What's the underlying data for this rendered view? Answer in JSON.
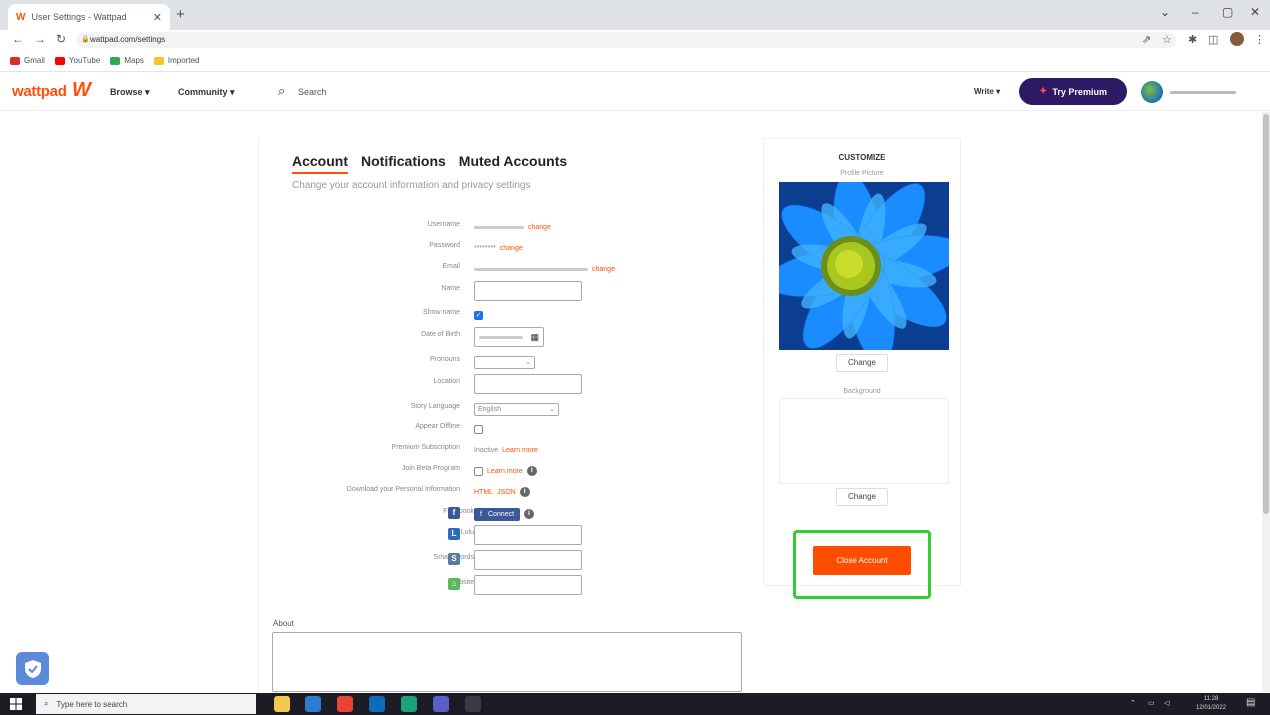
{
  "browser": {
    "tab_title": "User Settings - Wattpad",
    "url": "wattpad.com/settings",
    "bookmarks": [
      {
        "label": "Gmail",
        "color": "#d93025"
      },
      {
        "label": "YouTube",
        "color": "#ff0000"
      },
      {
        "label": "Maps",
        "color": "#34a853"
      },
      {
        "label": "Imported",
        "color": "#f4c430"
      }
    ]
  },
  "header": {
    "logo": "wattpad",
    "browse": "Browse ▾",
    "community": "Community ▾",
    "search_placeholder": "Search",
    "write": "Write ▾",
    "premium": "Try Premium"
  },
  "settings": {
    "tabs": [
      "Account",
      "Notifications",
      "Muted Accounts"
    ],
    "subtitle": "Change your account information and privacy settings",
    "labels": {
      "username": "Username",
      "password": "Password",
      "email": "Email",
      "name": "Name",
      "show_name": "Show name",
      "dob": "Date of Birth",
      "pronouns": "Pronouns",
      "location": "Location",
      "story_language": "Story Language",
      "appear_offline": "Appear Offline",
      "premium_subscription": "Premium Subscription",
      "beta": "Join Beta Program",
      "download": "Download your Personal Information",
      "facebook": "Facebook",
      "lulu": "Lulu",
      "smashwords": "Smashwords",
      "website": "Website"
    },
    "change_link": "change",
    "password_mask": "********",
    "language_value": "English",
    "premium_status": "Inactive",
    "learn_more": "Learn more",
    "beta_learn_more": "Learn more",
    "download_html": "HTML",
    "download_json": "JSON",
    "facebook_connect": "Connect",
    "about_label": "About"
  },
  "customize": {
    "title": "CUSTOMIZE",
    "profile_picture": "Profile Picture",
    "change": "Change",
    "background": "Background",
    "change2": "Change",
    "close_account": "Close Account"
  },
  "taskbar": {
    "search_placeholder": "Type here to search",
    "time": "11:28",
    "date": "12/01/2022"
  },
  "colors": {
    "brand": "#ff500a",
    "premium_bg": "#2d1a64",
    "highlight": "#33cc33"
  }
}
